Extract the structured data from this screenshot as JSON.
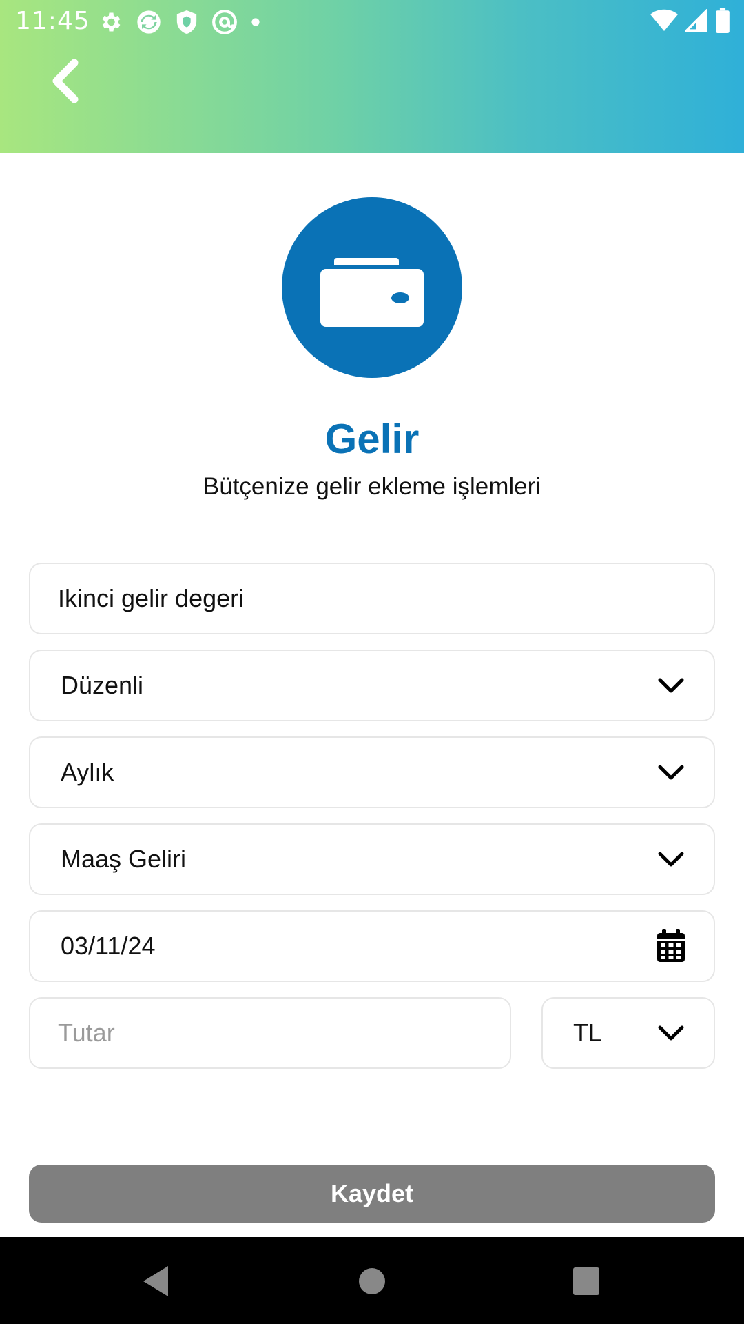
{
  "status_bar": {
    "time": "11:45",
    "left_icons": [
      "settings-icon",
      "sync-icon",
      "shield-icon",
      "at-icon",
      "dot-icon"
    ],
    "right_icons": [
      "wifi-icon",
      "signal-icon",
      "battery-icon"
    ]
  },
  "header": {
    "back_icon": "chevron-left-icon",
    "gradient_colors": [
      "#a8e67f",
      "#2fb0d8"
    ]
  },
  "hero": {
    "icon": "wallet-icon",
    "icon_bg_color": "#0a72b6",
    "title": "Gelir",
    "subtitle": "Bütçenize gelir ekleme işlemleri"
  },
  "form": {
    "description_value": "Ikinci gelir degeri",
    "type_select": "Düzenli",
    "period_select": "Aylık",
    "category_select": "Maaş Geliri",
    "date_value": "03/11/24",
    "amount_placeholder": "Tutar",
    "currency_select": "TL"
  },
  "actions": {
    "save_label": "Kaydet",
    "save_color": "#7f7f7f"
  },
  "nav_bar": {
    "icons": [
      "back-triangle-icon",
      "home-circle-icon",
      "recents-square-icon"
    ]
  }
}
